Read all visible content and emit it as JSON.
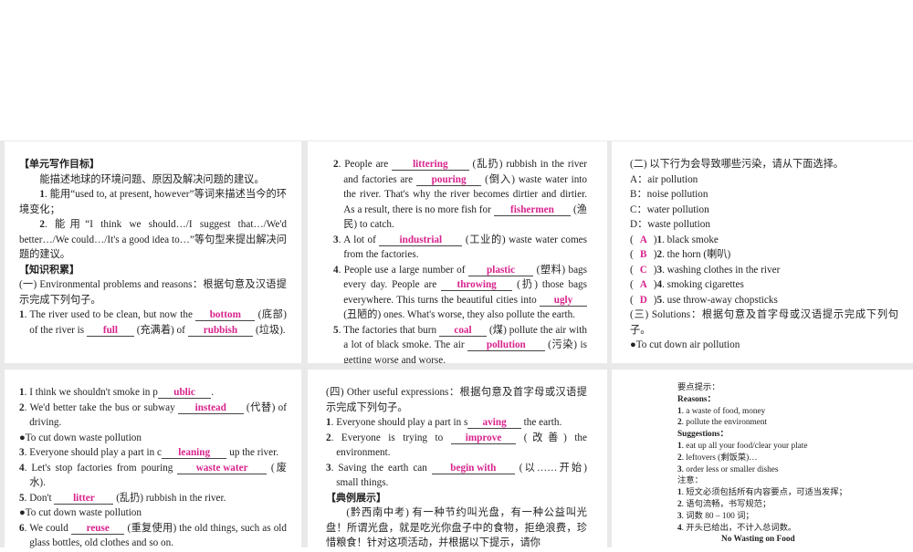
{
  "accent_color": "#d8238c",
  "panels": [
    {
      "blocks": [
        {
          "type": "h",
          "segs": [
            "【单元写作目标】"
          ]
        },
        {
          "type": "ind",
          "segs": [
            "能描述地球的环境问题、原因及解决问题的建议。"
          ]
        },
        {
          "type": "ind",
          "num": "1",
          "segs": [
            ". 能用“used to, at present, however”等词来描述当今的环境变化；"
          ]
        },
        {
          "type": "ind",
          "num": "2",
          "segs": [
            ". 能用“I think we should…/I suggest that…/We'd better…/We could…/It's a good idea to…”等句型来提出解决问题的建议。"
          ]
        },
        {
          "type": "h",
          "segs": [
            "【知识积累】"
          ]
        },
        {
          "type": "p",
          "segs": [
            "(一) Environmental problems and reasons：根据句意及汉语提示完成下列句子。"
          ]
        },
        {
          "type": "item",
          "num": "1",
          "segs": [
            ". The river used to be clean, but now the ",
            {
              "ans": "bottom"
            },
            " (底部) of the river is ",
            {
              "ans": "full"
            },
            " (充满着) of ",
            {
              "ans": "rubbish"
            },
            " (垃圾)."
          ]
        }
      ]
    },
    {
      "blocks": [
        {
          "type": "item",
          "num": "2",
          "segs": [
            ". People are ",
            {
              "ans": "littering"
            },
            " (乱扔) rubbish in the river and factories are ",
            {
              "ans": "pouring"
            },
            " (倒入) waste water into the river. That's why the river becomes dirtier and dirtier. As a result, there is no more fish for ",
            {
              "ans": "fishermen"
            },
            " (渔民) to catch."
          ]
        },
        {
          "type": "item",
          "num": "3",
          "segs": [
            ". A lot of ",
            {
              "ans": "industrial"
            },
            " (工业的) waste water comes from the factories."
          ]
        },
        {
          "type": "item",
          "num": "4",
          "segs": [
            ". People use a large number of ",
            {
              "ans": "plastic"
            },
            " (塑料) bags every day. People are ",
            {
              "ans": "throwing"
            },
            " (扔) those bags everywhere. This turns the beautiful cities into ",
            {
              "ans": "ugly"
            },
            " (丑陋的) ones. What's worse, they also pollute the earth."
          ]
        },
        {
          "type": "item",
          "num": "5",
          "segs": [
            ". The factories that burn ",
            {
              "ans": "coal"
            },
            " (煤) pollute the air with a lot of black smoke. The air ",
            {
              "ans": "pollution"
            },
            " (污染) is getting worse and worse."
          ]
        }
      ]
    },
    {
      "blocks": [
        {
          "type": "p",
          "segs": [
            "(二) 以下行为会导致哪些污染，请从下面选择。"
          ]
        },
        {
          "type": "p",
          "segs": [
            "A：air pollution"
          ]
        },
        {
          "type": "p",
          "segs": [
            "B：noise pollution"
          ]
        },
        {
          "type": "p",
          "segs": [
            "C：water pollution"
          ]
        },
        {
          "type": "p",
          "segs": [
            "D：waste pollution"
          ]
        },
        {
          "type": "choice",
          "choice": "A",
          "num": "1",
          "segs": [
            ". black smoke"
          ]
        },
        {
          "type": "choice",
          "choice": "B",
          "num": "2",
          "segs": [
            ". the horn (喇叭)"
          ]
        },
        {
          "type": "choice",
          "choice": "C",
          "num": "3",
          "segs": [
            ". washing clothes in the river"
          ]
        },
        {
          "type": "choice",
          "choice": "A",
          "num": "4",
          "segs": [
            ". smoking cigarettes"
          ]
        },
        {
          "type": "choice",
          "choice": "D",
          "num": "5",
          "segs": [
            ". use throw-away chopsticks"
          ]
        },
        {
          "type": "p",
          "segs": [
            "(三) Solutions：根据句意及首字母或汉语提示完成下列句子。"
          ]
        },
        {
          "type": "p",
          "segs": [
            "●To cut down air pollution"
          ]
        }
      ]
    },
    {
      "blocks": [
        {
          "type": "item",
          "num": "1",
          "segs": [
            ". I think we shouldn't smoke in p",
            {
              "ans": "ublic"
            },
            "."
          ]
        },
        {
          "type": "item",
          "num": "2",
          "segs": [
            ". We'd better take the bus or subway ",
            {
              "ans": "instead"
            },
            " (代替) of driving."
          ]
        },
        {
          "type": "p",
          "segs": [
            "●To cut down waste pollution"
          ]
        },
        {
          "type": "item",
          "num": "3",
          "segs": [
            ". Everyone should play a part in c",
            {
              "ans": "leaning"
            },
            " up the river."
          ]
        },
        {
          "type": "item",
          "num": "4",
          "segs": [
            ". Let's stop factories from pouring ",
            {
              "ans": "waste water"
            },
            " (废水)."
          ]
        },
        {
          "type": "item",
          "num": "5",
          "segs": [
            ". Don't ",
            {
              "ans": "litter"
            },
            " (乱扔) rubbish in the river."
          ]
        },
        {
          "type": "p",
          "segs": [
            "●To cut down waste pollution"
          ]
        },
        {
          "type": "item",
          "num": "6",
          "segs": [
            ". We could ",
            {
              "ans": "reuse"
            },
            " (重复使用) the old things, such as old glass bottles, old clothes and so on."
          ]
        }
      ]
    },
    {
      "blocks": [
        {
          "type": "p",
          "segs": [
            "(四) Other useful expressions：根据句意及首字母或汉语提示完成下列句子。"
          ]
        },
        {
          "type": "item",
          "num": "1",
          "segs": [
            ". Everyone should play a part in s",
            {
              "ans": "aving"
            },
            " the earth."
          ]
        },
        {
          "type": "item",
          "num": "2",
          "segs": [
            ". Everyone is trying to ",
            {
              "ans": "improve"
            },
            " (改善) the environment."
          ]
        },
        {
          "type": "item",
          "num": "3",
          "segs": [
            ". Saving the earth can ",
            {
              "ans": "begin with"
            },
            " (以……开始) small things."
          ]
        },
        {
          "type": "h",
          "segs": [
            "【典例展示】"
          ]
        },
        {
          "type": "ind",
          "segs": [
            "(黔西南中考) 有一种节约叫光盘，有一种公益叫光盘！所谓光盘，就是吃光你盘子中的食物，拒绝浪费，珍惜粮食！针对这项活动，并根据以下提示，请你"
          ]
        }
      ]
    },
    {
      "blocks": [
        {
          "type": "p",
          "segs": [
            "要点提示："
          ]
        },
        {
          "type": "b",
          "segs": [
            "Reasons："
          ]
        },
        {
          "type": "p",
          "num": "1",
          "segs": [
            ". a waste of food, money"
          ]
        },
        {
          "type": "p",
          "num": "2",
          "segs": [
            ". pollute the environment"
          ]
        },
        {
          "type": "b",
          "segs": [
            "Suggestions："
          ]
        },
        {
          "type": "p",
          "num": "1",
          "segs": [
            ". eat up all your food/clear your plate"
          ]
        },
        {
          "type": "p",
          "num": "2",
          "segs": [
            ". leftovers (剩饭菜)…"
          ]
        },
        {
          "type": "p",
          "num": "3",
          "segs": [
            ". order less or smaller dishes"
          ]
        },
        {
          "type": "p",
          "segs": [
            "注意："
          ]
        },
        {
          "type": "p",
          "num": "1",
          "segs": [
            ". 短文必须包括所有内容要点，可适当发挥；"
          ]
        },
        {
          "type": "p",
          "num": "2",
          "segs": [
            ". 语句流畅，书写规范；"
          ]
        },
        {
          "type": "p",
          "num": "3",
          "segs": [
            ". 词数 80 – 100 词；"
          ]
        },
        {
          "type": "p",
          "num": "4",
          "segs": [
            ". 开头已给出，不计入总词数。"
          ]
        },
        {
          "type": "title",
          "segs": [
            "No Wasting on Food"
          ]
        }
      ]
    }
  ]
}
